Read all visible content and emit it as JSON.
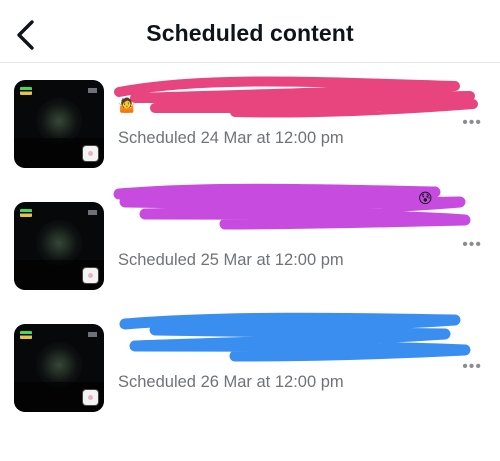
{
  "header": {
    "title": "Scheduled content"
  },
  "posts": [
    {
      "scheduled_text": "Scheduled 24 Mar at 12:00 pm",
      "more_label": "•••",
      "scribble_color": "#e8447e"
    },
    {
      "scheduled_text": "Scheduled 25 Mar at 12:00 pm",
      "more_label": "•••",
      "scribble_color": "#c84be0"
    },
    {
      "scheduled_text": "Scheduled 26 Mar at 12:00 pm",
      "more_label": "•••",
      "scribble_color": "#3a8ef0"
    }
  ],
  "icons": {
    "back": "chevron-left-icon",
    "more": "more-horizontal-icon",
    "thumbnail_badge": "camera-icon"
  }
}
